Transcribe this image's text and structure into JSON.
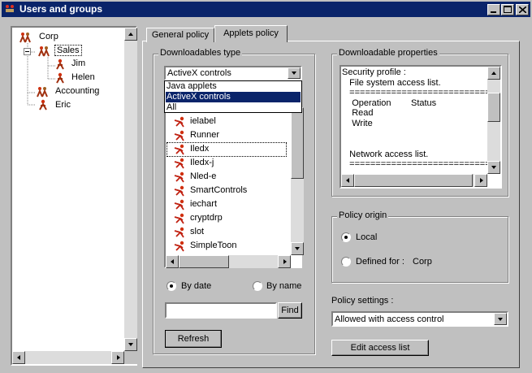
{
  "window": {
    "title": "Users and groups"
  },
  "tree": {
    "nodes": [
      {
        "label": "Corp",
        "icon": "group-icon"
      },
      {
        "label": "Sales",
        "icon": "group-icon",
        "selected": true,
        "expander": "−"
      },
      {
        "label": "Jim",
        "icon": "user-icon"
      },
      {
        "label": "Helen",
        "icon": "user-icon"
      },
      {
        "label": "Accounting",
        "icon": "group-icon"
      },
      {
        "label": "Eric",
        "icon": "user-icon"
      }
    ]
  },
  "tabs": {
    "general": "General policy",
    "applets": "Applets policy",
    "active": "applets"
  },
  "downloadables": {
    "label": "Downloadables type",
    "selected": "ActiveX controls",
    "options": [
      "Java applets",
      "ActiveX controls",
      "All"
    ],
    "list_items": [
      "ielabel",
      "Runner",
      "Iledx",
      "Iledx-j",
      "Nled-e",
      "SmartControls",
      "iechart",
      "cryptdrp",
      "slot",
      "SimpleToon"
    ],
    "focused_item": "Iledx",
    "sort_by_date": "By date",
    "sort_by_name": "By name",
    "sort_selected": "By date",
    "find_value": "",
    "find_label": "Find",
    "refresh_label": "Refresh"
  },
  "properties": {
    "label": "Downloadable properties",
    "lines": [
      "Security profile :",
      "   File system access list.",
      "   ===========================",
      "    Operation        Status",
      "    Read",
      "    Write",
      "",
      "",
      "   Network access list.",
      "   ==========================="
    ]
  },
  "policy_origin": {
    "label": "Policy origin",
    "local": "Local",
    "defined_for": "Defined for :",
    "defined_for_value": "Corp",
    "selected": "Local"
  },
  "policy_settings": {
    "label": "Policy settings :",
    "value": "Allowed with access control",
    "edit_label": "Edit access list"
  },
  "colors": {
    "title_bg": "#0a246a",
    "selection": "#0a246a",
    "face": "#c0c0c0"
  }
}
